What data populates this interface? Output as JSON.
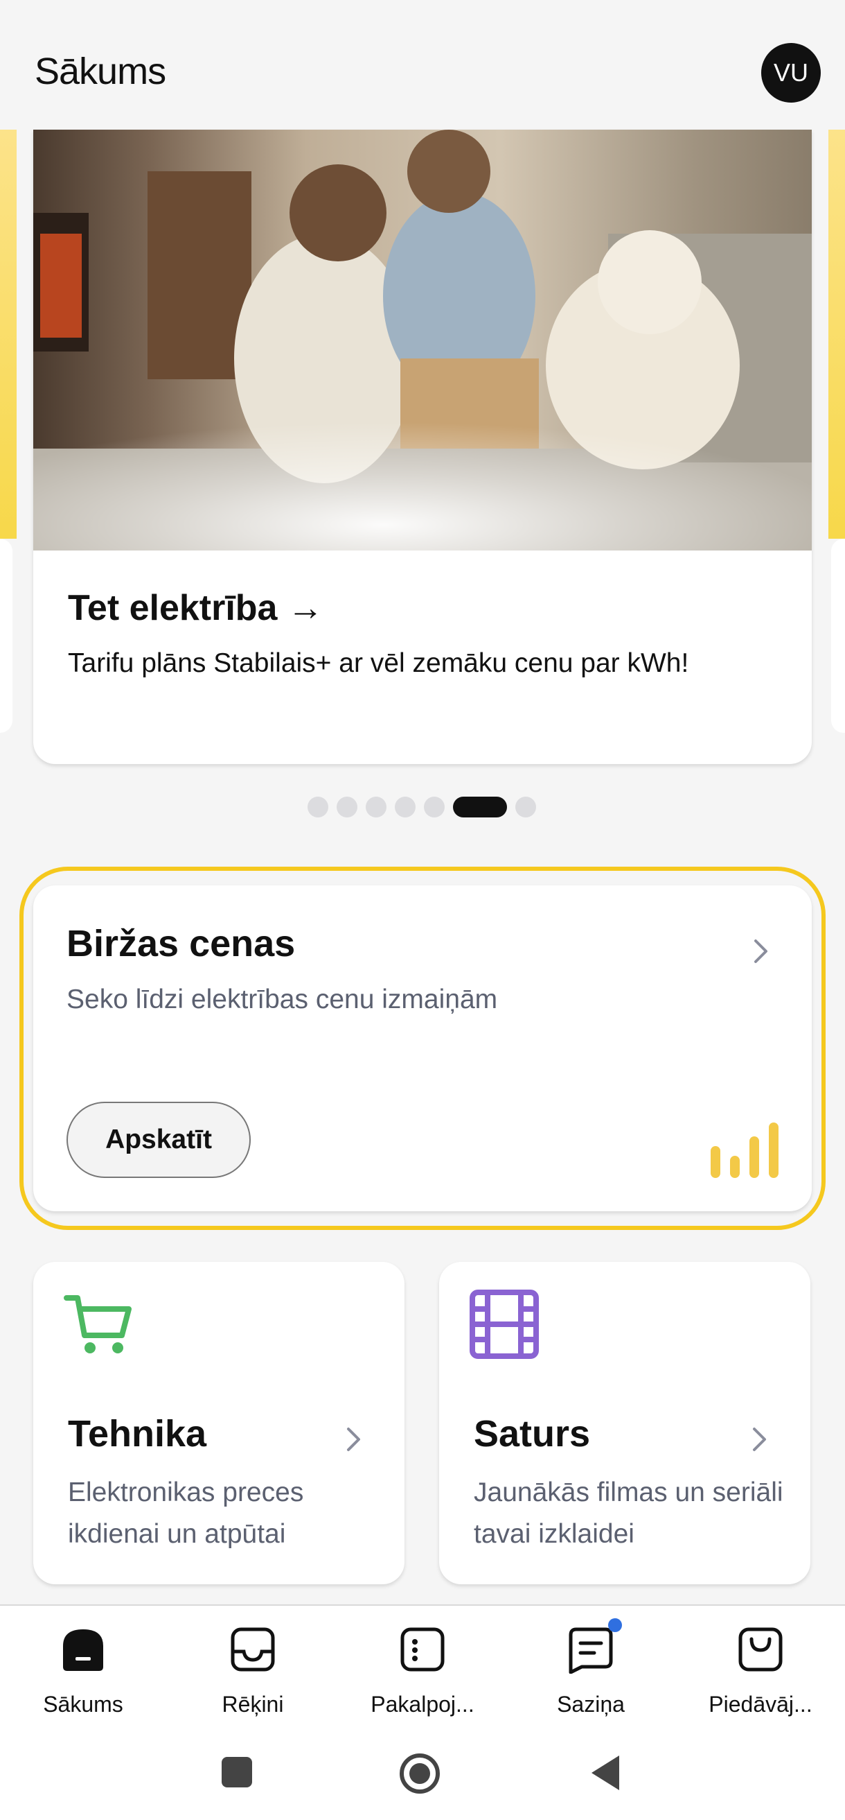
{
  "header": {
    "title": "Sākums",
    "avatar_initials": "VU"
  },
  "promo": {
    "title": "Tet elektrība →",
    "subtitle": "Tarifu plāns Stabilais+ ar vēl zemāku cenu par kWh!",
    "image": "photo of mother, child and white dog on sofa with fairy lights",
    "carousel": {
      "total": 7,
      "active_index": 5
    }
  },
  "price_card": {
    "title": "Biržas cenas",
    "subtitle": "Seko līdzi elektrības cenu izmaiņām",
    "button_label": "Apskatīt",
    "icon": "bar-chart-icon",
    "highlight_color": "#f5c81e"
  },
  "tiles": [
    {
      "icon": "shopping-cart-icon",
      "icon_color": "#4cb861",
      "title": "Tehnika",
      "description": "Elektronikas preces ikdienai un atpūtai"
    },
    {
      "icon": "film-icon",
      "icon_color": "#8a63d2",
      "title": "Saturs",
      "description": "Jaunākās filmas un seriāli tavai izklaidei"
    }
  ],
  "bottom_nav": [
    {
      "label": "Sākums",
      "icon": "home-icon",
      "active": true
    },
    {
      "label": "Rēķini",
      "icon": "inbox-icon",
      "active": false
    },
    {
      "label": "Pakalpoj...",
      "icon": "services-icon",
      "active": false
    },
    {
      "label": "Saziņa",
      "icon": "chat-icon",
      "active": false,
      "notification": true
    },
    {
      "label": "Piedāvāj...",
      "icon": "shopping-bag-icon",
      "active": false
    }
  ],
  "system_nav": [
    "recents-icon",
    "home-circle-icon",
    "back-icon"
  ]
}
